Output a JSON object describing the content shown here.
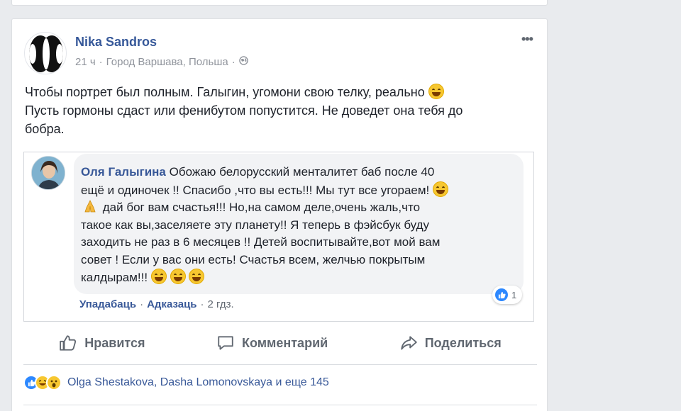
{
  "post": {
    "author": "Nika Sandros",
    "time": "21 ч",
    "location": "Город Варшава, Польша",
    "text_line1": "Чтобы портрет был полным. Галыгин, угомони свою телку, реально",
    "text_line2": "Пусть гормоны сдаст или фенибутом попустится. Не доведет она тебя до",
    "text_line3": "бобра."
  },
  "comment": {
    "name": "Оля Галыгина",
    "line1": "Обожаю белорусский менталитет баб после 40",
    "line2": "ещё и одиночек !! Спасибо ,что вы есть!!! Мы тут все угораем!",
    "line3": "дай бог вам счастья!!! Но,на самом деле,очень жаль,что",
    "line4": "такое как вы,заселяете эту планету!! Я теперь в фэйсбук буду",
    "line5": "заходить не раз в 6 месяцев !! Детей воспитывайте,вот мой вам",
    "line6": "совет ! Если у вас они есть! Счастья всем, желчью покрытым",
    "line7": "калдырам!!!",
    "like_count": "1",
    "action_like": "Упадабаць",
    "action_reply": "Адказаць",
    "time": "2 гдз."
  },
  "actions": {
    "like": "Нравится",
    "comment": "Комментарий",
    "share": "Поделиться"
  },
  "reactions": {
    "names": "Olga Shestakova, Dasha Lomonovskaya и еще 145"
  },
  "colors": {
    "link": "#365899",
    "background": "#e9ebee",
    "like_blue": "#2d88ff"
  }
}
